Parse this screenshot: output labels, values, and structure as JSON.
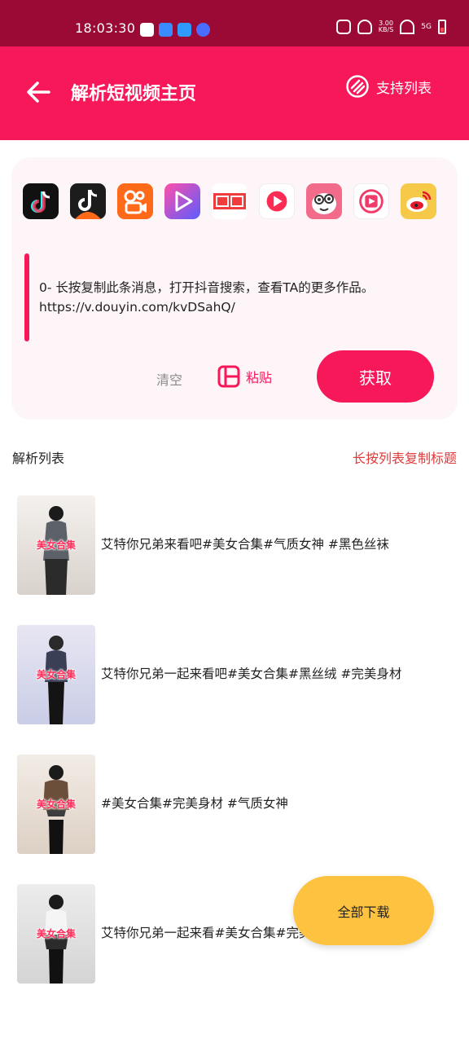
{
  "status": {
    "time": "18:03:30",
    "net_speed_top": "3.00",
    "net_speed_bottom": "KB/S",
    "signal": "5G"
  },
  "header": {
    "title": "解析短视频主页",
    "support_label": "支持列表"
  },
  "platforms": [
    {
      "icon": "douyin-icon",
      "color": "#111111"
    },
    {
      "icon": "douyin-lite-icon",
      "color": "#1c1c1c"
    },
    {
      "icon": "kuaishou-icon",
      "color": "#ff6a1a"
    },
    {
      "icon": "video-play-icon",
      "color": "#6a5cff"
    },
    {
      "icon": "toutiao-icon",
      "color": "#f03c3c"
    },
    {
      "icon": "xigua-icon",
      "color": "#ffffff"
    },
    {
      "icon": "pipixia-icon",
      "color": "#f36b8a"
    },
    {
      "icon": "weishi-icon",
      "color": "#ffffff"
    },
    {
      "icon": "weibo-icon",
      "color": "#f7c948"
    }
  ],
  "input": {
    "text_line1": "0- 长按复制此条消息，打开抖音搜索，查看TA的更多作品。",
    "text_line2": "https://v.douyin.com/kvDSahQ/"
  },
  "actions": {
    "clear": "清空",
    "paste": "粘贴",
    "get": "获取"
  },
  "list": {
    "title": "解析列表",
    "hint": "长按列表复制标题",
    "items": [
      {
        "title": "艾特你兄弟来看吧#美女合集#气质女神 #黑色丝袜",
        "thumb_label": "美女合集"
      },
      {
        "title": "艾特你兄弟一起来看吧#美女合集#黑丝绒 #完美身材",
        "thumb_label": "美女合集"
      },
      {
        "title": "#美女合集#完美身材 #气质女神",
        "thumb_label": "美女合集"
      },
      {
        "title": "艾特你兄弟一起来看#美女合集#完美身材",
        "thumb_label": "美女合集"
      }
    ]
  },
  "fab": {
    "label": "全部下载"
  },
  "colors": {
    "primary": "#f7185a",
    "status_bar": "#9a0a35",
    "fab": "#fdc340",
    "hint": "#e03a3a"
  }
}
